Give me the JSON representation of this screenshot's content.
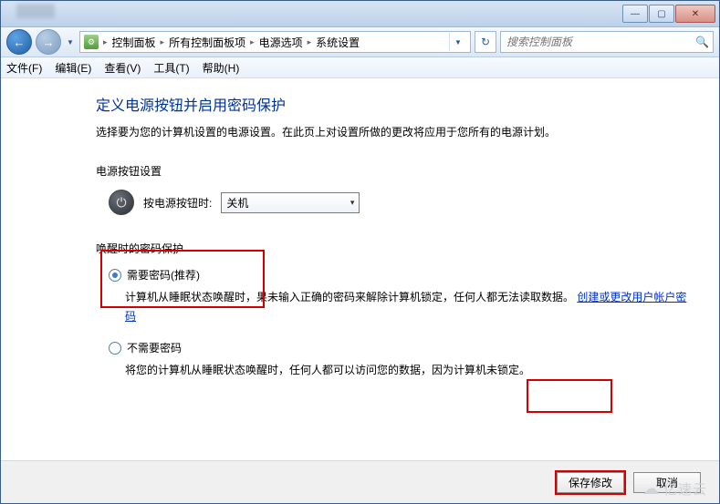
{
  "titlebar": {
    "min": "—",
    "max": "▢",
    "close": "✕"
  },
  "nav": {
    "back_glyph": "←",
    "fwd_glyph": "→",
    "dd_glyph": "▼",
    "refresh_glyph": "↻"
  },
  "breadcrumb": {
    "icon_glyph": "⚙",
    "sep": "▸",
    "segs": [
      "控制面板",
      "所有控制面板项",
      "电源选项",
      "系统设置"
    ]
  },
  "search": {
    "placeholder": "搜索控制面板",
    "icon": "🔍"
  },
  "menu": {
    "file": "文件(F)",
    "edit": "编辑(E)",
    "view": "查看(V)",
    "tools": "工具(T)",
    "help": "帮助(H)"
  },
  "page": {
    "title": "定义电源按钮并启用密码保护",
    "desc": "选择要为您的计算机设置的电源设置。在此页上对设置所做的更改将应用于您所有的电源计划。",
    "section_power": "电源按钮设置",
    "power_icon": "⏻",
    "power_label": "按电源按钮时:",
    "power_value": "关机",
    "dd_arrow": "▾",
    "section_wake": "唤醒时的密码保护",
    "opt1_label": "需要密码(推荐)",
    "opt1_desc_a": "计算机从睡眠状态唤醒时，",
    "opt1_desc_b": "果未输入正确的密码来解除计算机锁定，任何人都无法读取数据。",
    "opt1_link": "创建或更改用户帐户密码",
    "opt2_label": "不需要密码",
    "opt2_desc": "将您的计算机从睡眠状态唤醒时，任何人都可以访问您的数据，因为计算机未锁定。"
  },
  "footer": {
    "save": "保存修改",
    "cancel": "取消"
  },
  "watermark": "亿速云"
}
